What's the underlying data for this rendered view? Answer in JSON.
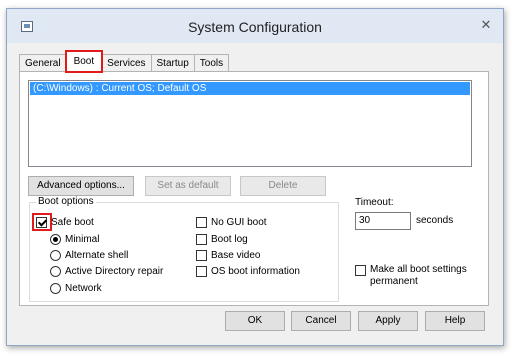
{
  "window": {
    "title": "System Configuration"
  },
  "icons": {
    "app": "msconfig-icon",
    "close": "close-icon"
  },
  "tabs": [
    {
      "label": "General",
      "active": false
    },
    {
      "label": "Boot",
      "active": true
    },
    {
      "label": "Services",
      "active": false
    },
    {
      "label": "Startup",
      "active": false
    },
    {
      "label": "Tools",
      "active": false
    }
  ],
  "boot": {
    "os_entries": [
      "(C:\\Windows) : Current OS; Default OS"
    ],
    "buttons": {
      "advanced": "Advanced options...",
      "set_default": "Set as default",
      "delete": "Delete"
    },
    "boot_options": {
      "group_label": "Boot options",
      "safe_boot": {
        "label": "Safe boot",
        "checked": true
      },
      "safe_modes": [
        {
          "label": "Minimal",
          "selected": true
        },
        {
          "label": "Alternate shell",
          "selected": false
        },
        {
          "label": "Active Directory repair",
          "selected": false
        },
        {
          "label": "Network",
          "selected": false
        }
      ],
      "flags": [
        {
          "label": "No GUI boot",
          "checked": false
        },
        {
          "label": "Boot log",
          "checked": false
        },
        {
          "label": "Base video",
          "checked": false
        },
        {
          "label": "OS boot information",
          "checked": false
        }
      ]
    },
    "timeout": {
      "label": "Timeout:",
      "value": "30",
      "unit": "seconds"
    },
    "make_permanent": {
      "line1": "Make all boot settings",
      "line2": "permanent",
      "checked": false
    }
  },
  "footer": {
    "ok": "OK",
    "cancel": "Cancel",
    "apply": "Apply",
    "help": "Help"
  },
  "colors": {
    "highlight": "#e01b1b",
    "selection": "#3399ff"
  }
}
